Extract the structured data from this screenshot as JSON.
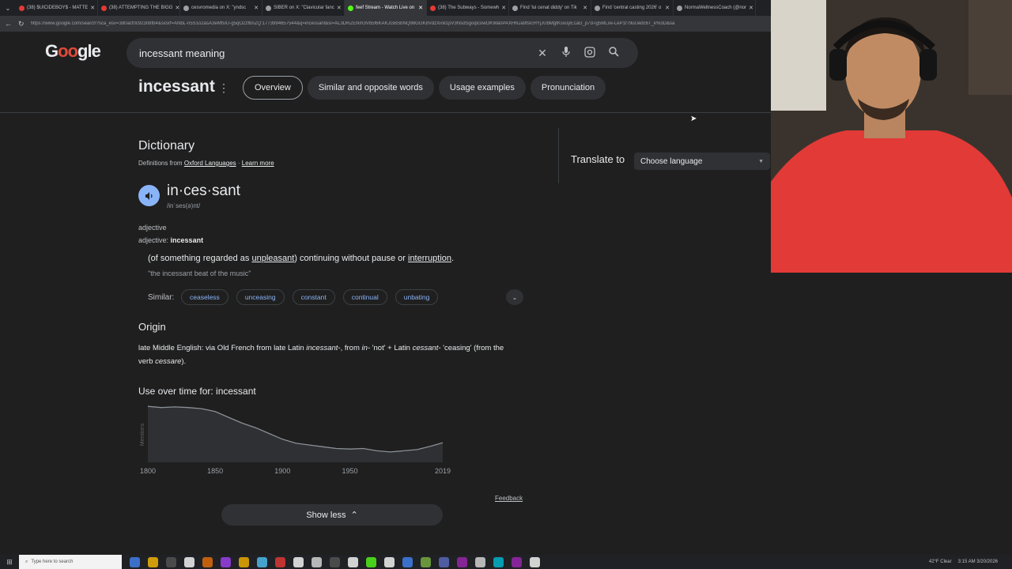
{
  "tabs": [
    {
      "label": "(38) $UICIDEBOY$ - MATTE",
      "color": "#e53935"
    },
    {
      "label": "(38) ATTEMPTING THE BIGG",
      "color": "#e53935"
    },
    {
      "label": "cesvromedia on X: \"yndsc",
      "color": "#9aa0a6"
    },
    {
      "label": "SIBER on X: \"Clavicular fanc",
      "color": "#9aa0a6"
    },
    {
      "label": "feef Stream - Watch Live on",
      "color": "#53fc18"
    },
    {
      "label": "(38) The Subways - Somewh",
      "color": "#e53935"
    },
    {
      "label": "Find 'lui cenat diddy' on Tik",
      "color": "#9aa0a6"
    },
    {
      "label": "Find 'central casting 2026' o",
      "color": "#9aa0a6"
    },
    {
      "label": "NormaWellnessCoach (@nor",
      "color": "#9aa0a6"
    }
  ],
  "address": "https://www.google.com/search?sca_esv=3d0acf0c92308fb4&sxsrf=ANbL-n5S1o2asA3eMfsIU-g5qO2zfbnZQ:1773994657544&q=incessant&si=AL3DRZENm3Vb5f6KAKJGBSbNQ98GGK8VdzXiniI1pV3NsdSgoqlcowOKWa0PAXHNJa9fsIcHYjJUbMgtKsxuyE1aG_p7d-Ig5MLxe-LeP1f79uUedc6T_k%3D&sa",
  "logo": {
    "pre": "G",
    "doodle": "oo",
    "post": "gle"
  },
  "search": {
    "query": "incessant meaning"
  },
  "term": "incessant",
  "chips": [
    "Overview",
    "Similar and opposite words",
    "Usage examples",
    "Pronunciation"
  ],
  "dictionary": {
    "heading": "Dictionary",
    "source_prefix": "Definitions from",
    "source_name": "Oxford Languages",
    "source_sep": " · ",
    "learn_more": "Learn more",
    "headword": "in·ces·sant",
    "phonetic": "/inˈses(ə)nt/",
    "pos": "adjective",
    "pos_label": "adjective:",
    "pos_word": "incessant",
    "def_open": "(of something regarded as ",
    "def_link1": "unpleasant",
    "def_mid": ") continuing without pause or ",
    "def_link2": "interruption",
    "def_end": ".",
    "example": "\"the incessant beat of the music\"",
    "similar_label": "Similar:",
    "similar": [
      "ceaseless",
      "unceasing",
      "constant",
      "continual",
      "unbating"
    ]
  },
  "origin": {
    "heading": "Origin",
    "t1": "late Middle English: via Old French from late Latin ",
    "i1": "incessant-",
    "t2": ", from ",
    "i2": "in-",
    "t3": " 'not' + Latin ",
    "i3": "cessant-",
    "t4": " 'ceasing' (from the verb ",
    "i4": "cessare",
    "t5": ")."
  },
  "usage": {
    "heading": "Use over time for: incessant",
    "ylabel": "Mentions",
    "feedback": "Feedback",
    "show_less": "Show less"
  },
  "chart_data": {
    "type": "area",
    "title": "Use over time for: incessant",
    "xlabel": "",
    "ylabel": "Mentions",
    "x_ticks": [
      1800,
      1850,
      1900,
      1950,
      2019
    ],
    "xlim": [
      1800,
      2019
    ],
    "ylim": [
      0,
      1
    ],
    "x": [
      1800,
      1810,
      1820,
      1830,
      1840,
      1850,
      1860,
      1870,
      1880,
      1890,
      1900,
      1910,
      1920,
      1930,
      1940,
      1950,
      1960,
      1970,
      1980,
      1990,
      2000,
      2010,
      2019
    ],
    "values": [
      0.97,
      0.95,
      0.96,
      0.95,
      0.93,
      0.88,
      0.78,
      0.68,
      0.6,
      0.5,
      0.4,
      0.33,
      0.3,
      0.27,
      0.24,
      0.23,
      0.24,
      0.2,
      0.18,
      0.2,
      0.22,
      0.28,
      0.34
    ],
    "grid": false,
    "legend": "none"
  },
  "translate": {
    "label": "Translate to",
    "placeholder": "Choose language"
  },
  "taskbar": {
    "search_placeholder": "Type here to search",
    "weather": "42°F Clear",
    "time": "3:15 AM",
    "date": "3/20/2026"
  }
}
